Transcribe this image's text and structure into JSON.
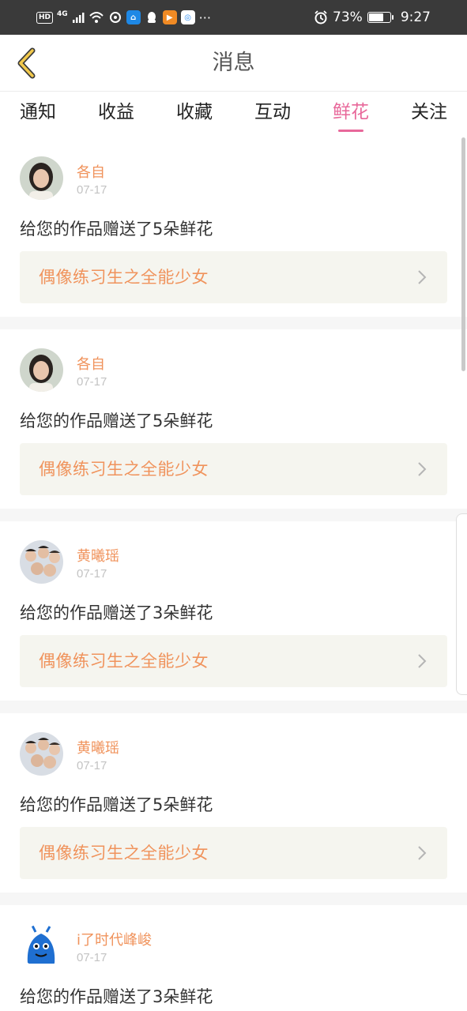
{
  "status_bar": {
    "hd": "HD",
    "network": "4G",
    "battery_percent_label": "73%",
    "battery_level": 0.73,
    "time": "9:27"
  },
  "header": {
    "title": "消息",
    "back_icon": "chevron-left-icon",
    "accent_color": "#f2c94c"
  },
  "tabs": [
    {
      "label": "通知",
      "active": false
    },
    {
      "label": "收益",
      "active": false
    },
    {
      "label": "收藏",
      "active": false
    },
    {
      "label": "互动",
      "active": false
    },
    {
      "label": "鲜花",
      "active": true
    },
    {
      "label": "关注",
      "active": false
    }
  ],
  "colors": {
    "active_tab": "#e8689a",
    "username": "#f0935c",
    "work_title": "#f0935c",
    "work_box_bg": "#f5f5ef"
  },
  "messages": [
    {
      "user": "各自",
      "date": "07-17",
      "text": "给您的作品赠送了5朵鲜花",
      "work": "偶像练习生之全能少女",
      "avatar": "girl-portrait-avatar"
    },
    {
      "user": "各自",
      "date": "07-17",
      "text": "给您的作品赠送了5朵鲜花",
      "work": "偶像练习生之全能少女",
      "avatar": "girl-portrait-avatar"
    },
    {
      "user": "黄曦瑶",
      "date": "07-17",
      "text": "给您的作品赠送了3朵鲜花",
      "work": "偶像练习生之全能少女",
      "avatar": "group-photo-avatar"
    },
    {
      "user": "黄曦瑶",
      "date": "07-17",
      "text": "给您的作品赠送了5朵鲜花",
      "work": "偶像练习生之全能少女",
      "avatar": "group-photo-avatar"
    },
    {
      "user": "i了时代峰峻",
      "date": "07-17",
      "text": "给您的作品赠送了3朵鲜花",
      "work": "",
      "avatar": "blue-cartoon-avatar"
    }
  ]
}
